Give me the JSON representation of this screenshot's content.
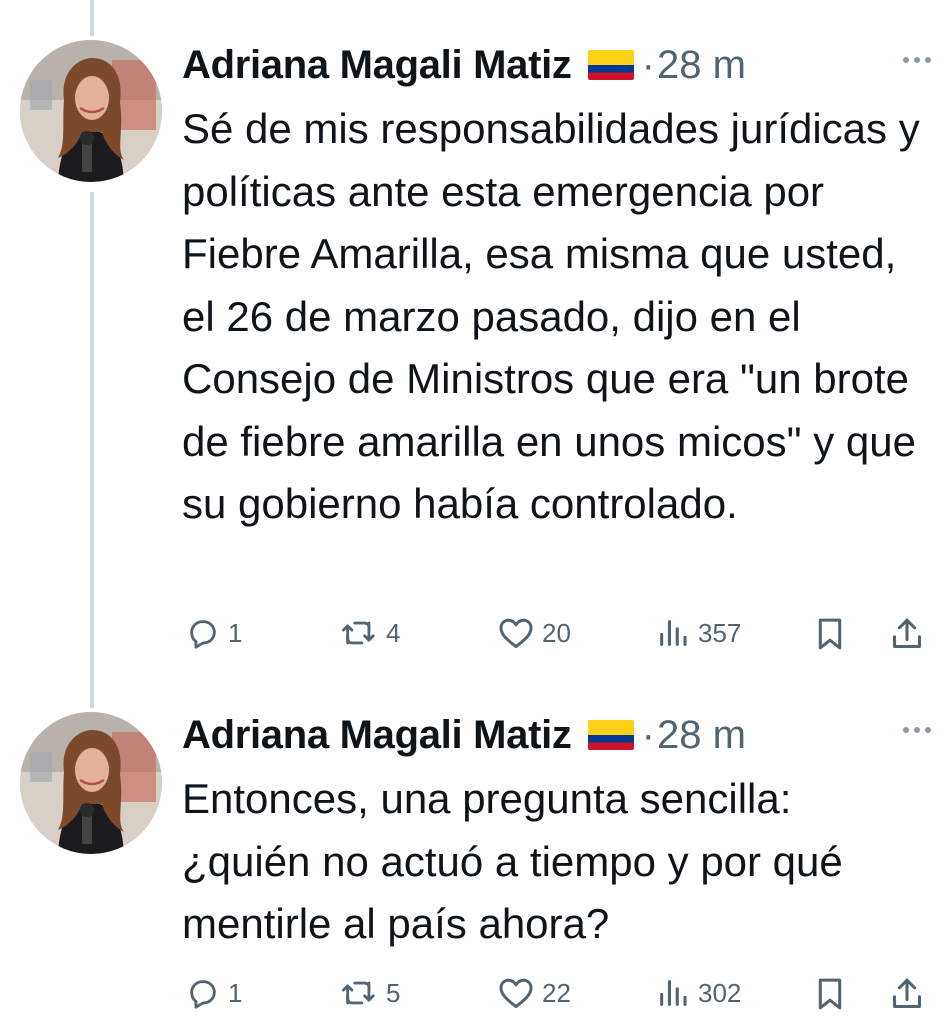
{
  "tweets": [
    {
      "author": "Adriana Magali Matiz",
      "time": "28 m",
      "text": "Sé de mis responsabilidades jurídicas y políticas ante esta emergencia por Fiebre Amarilla, esa misma que usted, el 26 de marzo pasado, dijo en el Consejo de Ministros que era \"un brote de fiebre amarilla en unos micos\" y que su gobierno había controlado.",
      "replies": "1",
      "reposts": "4",
      "likes": "20",
      "views": "357"
    },
    {
      "author": "Adriana Magali Matiz",
      "time": "28 m",
      "text": "Entonces, una pregunta sencilla: ¿quién no actuó a tiempo y por qué mentirle al país ahora?",
      "replies": "1",
      "reposts": "5",
      "likes": "22",
      "views": "302"
    }
  ],
  "icons": {
    "reply": "reply-icon",
    "repost": "repost-icon",
    "like": "heart-icon",
    "views": "views-icon",
    "bookmark": "bookmark-icon",
    "share": "share-icon",
    "more": "more-icon",
    "flag": "colombia-flag-icon"
  },
  "colors": {
    "text": "#0f1419",
    "secondary": "#536471",
    "thread_line": "#cfd9de",
    "flag_yellow": "#FCD116",
    "flag_blue": "#003893",
    "flag_red": "#CE1126"
  }
}
